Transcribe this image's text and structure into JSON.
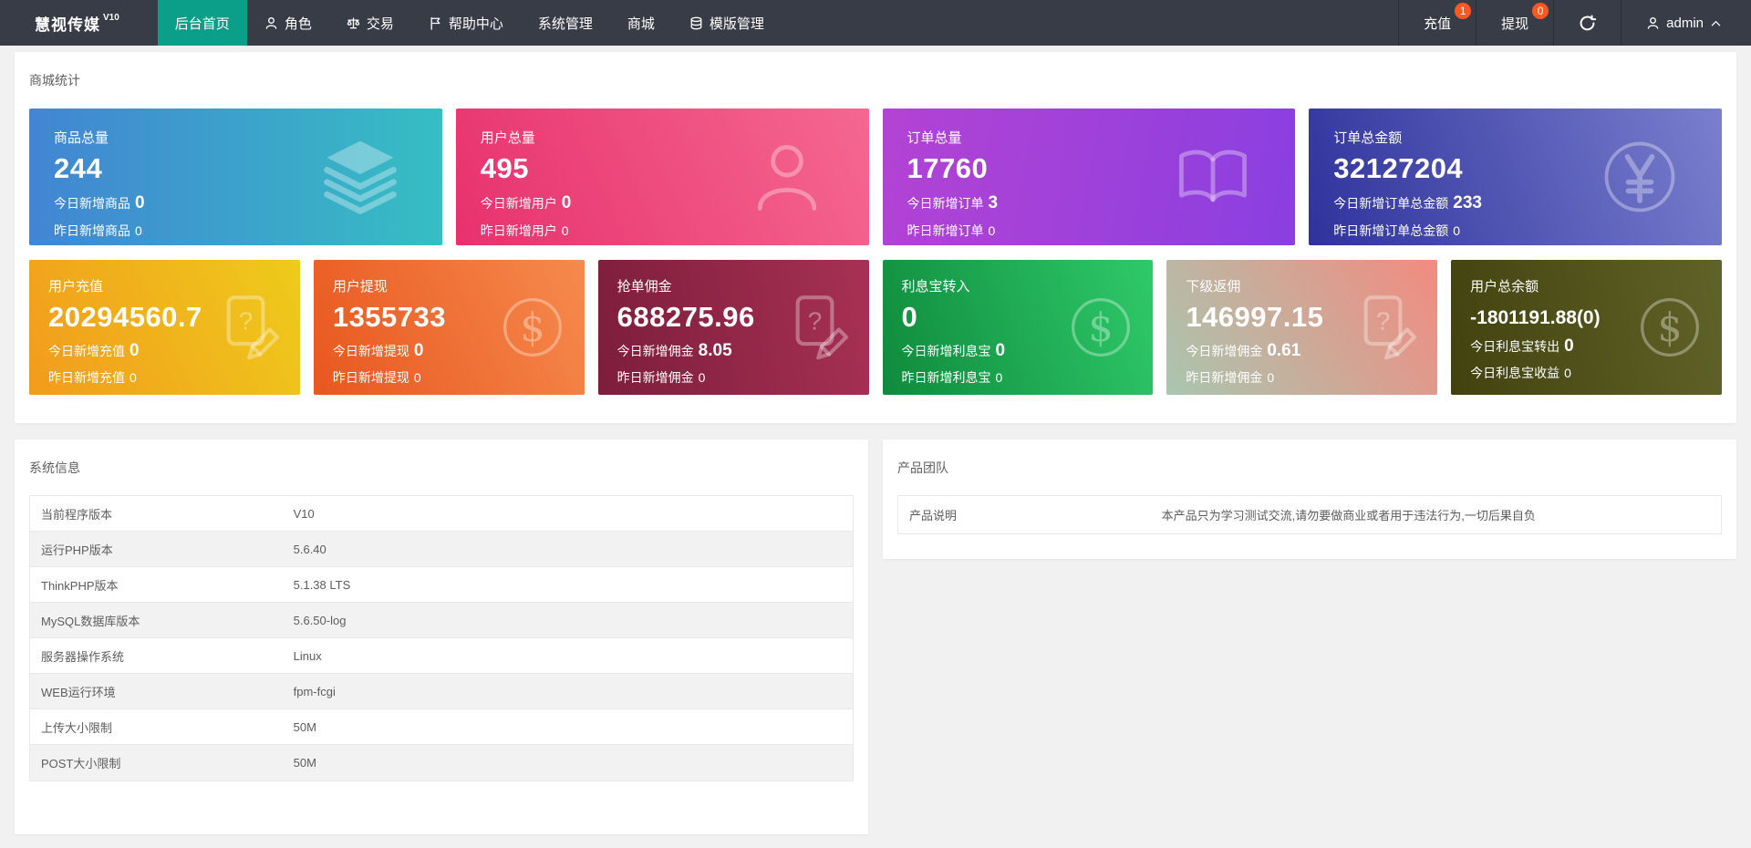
{
  "header": {
    "logo_text": "慧视传媒",
    "logo_version": "V10",
    "menu": [
      {
        "label": "后台首页",
        "icon": null,
        "active": true
      },
      {
        "label": "角色",
        "icon": "user-icon",
        "active": false
      },
      {
        "label": "交易",
        "icon": "scales-icon",
        "active": false
      },
      {
        "label": "帮助中心",
        "icon": "flag-icon",
        "active": false
      },
      {
        "label": "系统管理",
        "icon": null,
        "active": false
      },
      {
        "label": "商城",
        "icon": null,
        "active": false
      },
      {
        "label": "模版管理",
        "icon": "database-icon",
        "active": false
      }
    ],
    "actions": [
      {
        "label": "充值",
        "badge": "1"
      },
      {
        "label": "提现",
        "badge": "0"
      }
    ],
    "refresh_icon": "refresh-icon",
    "user": {
      "name": "admin",
      "icon": "user-icon",
      "caret": "chevron-up-icon"
    }
  },
  "colors": {
    "nav_bg": "#383c46",
    "nav_active": "#0b9e88",
    "badge": "#ff5722",
    "page_bg": "#f1f1f1"
  },
  "stats": {
    "title": "商城统计",
    "cards": [
      {
        "title": "商品总量",
        "value": "244",
        "sub1_label": "今日新增商品",
        "sub1_value": "0",
        "sub2_label": "昨日新增商品",
        "sub2_value": "0",
        "icon": "layers-icon",
        "gradient": {
          "angle": "90deg",
          "from": "#4285d3",
          "to": "#36bec3"
        }
      },
      {
        "title": "用户总量",
        "value": "495",
        "sub1_label": "今日新增用户",
        "sub1_value": "0",
        "sub2_label": "昨日新增用户",
        "sub2_value": "0",
        "icon": "user-icon",
        "gradient": {
          "angle": "65deg",
          "from": "#e7316e",
          "to": "#f56890"
        }
      },
      {
        "title": "订单总量",
        "value": "17760",
        "sub1_label": "今日新增订单",
        "sub1_value": "3",
        "sub2_label": "昨日新增订单",
        "sub2_value": "0",
        "icon": "book-icon",
        "gradient": {
          "angle": "100deg",
          "from": "#b343d4",
          "to": "#8a3fe0"
        }
      },
      {
        "title": "订单总金额",
        "value": "32127204",
        "sub1_label": "今日新增订单总金额",
        "sub1_value": "233",
        "sub2_label": "昨日新增订单总金额",
        "sub2_value": "0",
        "icon": "yen-circle-icon",
        "gradient": {
          "angle": "70deg",
          "from": "#2f329b",
          "to": "#7a7fce"
        }
      },
      {
        "title": "用户充值",
        "value": "20294560.7",
        "sub1_label": "今日新增充值",
        "sub1_value": "0",
        "sub2_label": "昨日新增充值",
        "sub2_value": "0",
        "icon": "document-edit-icon",
        "gradient": {
          "angle": "65deg",
          "from": "#f29b1d",
          "to": "#eecb1b"
        }
      },
      {
        "title": "用户提现",
        "value": "1355733",
        "sub1_label": "今日新增提现",
        "sub1_value": "0",
        "sub2_label": "昨日新增提现",
        "sub2_value": "0",
        "icon": "dollar-circle-icon",
        "gradient": {
          "angle": "65deg",
          "from": "#e8571f",
          "to": "#f68a4d"
        }
      },
      {
        "title": "抢单佣金",
        "value": "688275.96",
        "sub1_label": "今日新增佣金",
        "sub1_value": "8.05",
        "sub2_label": "昨日新增佣金",
        "sub2_value": "0",
        "icon": "document-edit-icon",
        "gradient": {
          "angle": "80deg",
          "from": "#7d1d3c",
          "to": "#a73154"
        }
      },
      {
        "title": "利息宝转入",
        "value": "0",
        "sub1_label": "今日新增利息宝",
        "sub1_value": "0",
        "sub2_label": "昨日新增利息宝",
        "sub2_value": "0",
        "icon": "dollar-circle-icon",
        "gradient": {
          "angle": "70deg",
          "from": "#0f8a3c",
          "to": "#2fca6a"
        }
      },
      {
        "title": "下级返佣",
        "value": "146997.15",
        "sub1_label": "今日新增佣金",
        "sub1_value": "0.61",
        "sub2_label": "昨日新增佣金",
        "sub2_value": "0",
        "icon": "document-edit-icon",
        "gradient": {
          "angle": "55deg",
          "from": "#a9c6af",
          "to": "#f28b80"
        }
      },
      {
        "title": "用户总余额",
        "value": "-1801191.88(0)",
        "sub1_label": "今日利息宝转出",
        "sub1_value": "0",
        "sub2_label": "今日利息宝收益",
        "sub2_value": "0",
        "icon": "dollar-circle-icon",
        "gradient": {
          "angle": "80deg",
          "from": "#42420f",
          "to": "#606328"
        }
      }
    ]
  },
  "system": {
    "title": "系统信息",
    "rows": [
      {
        "label": "当前程序版本",
        "value": "V10"
      },
      {
        "label": "运行PHP版本",
        "value": "5.6.40"
      },
      {
        "label": "ThinkPHP版本",
        "value": "5.1.38 LTS"
      },
      {
        "label": "MySQL数据库版本",
        "value": "5.6.50-log"
      },
      {
        "label": "服务器操作系统",
        "value": "Linux"
      },
      {
        "label": "WEB运行环境",
        "value": "fpm-fcgi"
      },
      {
        "label": "上传大小限制",
        "value": "50M"
      },
      {
        "label": "POST大小限制",
        "value": "50M"
      }
    ]
  },
  "team": {
    "title": "产品团队",
    "rows": [
      {
        "label": "产品说明",
        "value": "本产品只为学习测试交流,请勿要做商业或者用于违法行为,一切后果自负"
      }
    ]
  }
}
